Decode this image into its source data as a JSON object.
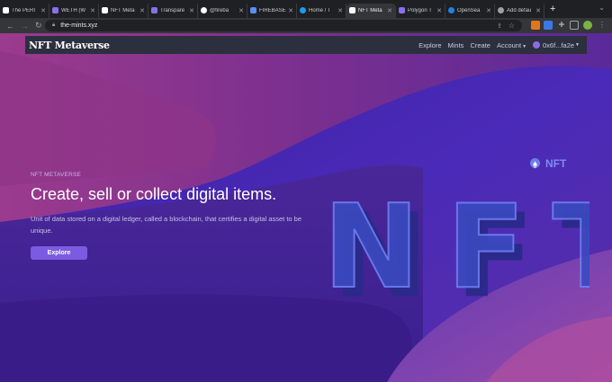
{
  "browser": {
    "tabs": [
      {
        "label": "The PERI",
        "icon": "w-icon",
        "color": "#ffffff"
      },
      {
        "label": "WETH (W",
        "icon": "polygon-icon",
        "color": "#8b6fe8"
      },
      {
        "label": "NFT Meta",
        "icon": "n-icon",
        "color": "#ffffff"
      },
      {
        "label": "Transpare",
        "icon": "polygon-icon",
        "color": "#8b6fe8"
      },
      {
        "label": "@fireba",
        "icon": "google-icon",
        "color": "#ffffff"
      },
      {
        "label": "FIREBASE",
        "icon": "firebase-icon",
        "color": "#5b8def"
      },
      {
        "label": "Home / T",
        "icon": "twitter-icon",
        "color": "#1d9bf0"
      },
      {
        "label": "NFT Meta",
        "icon": "n-icon",
        "color": "#ffffff",
        "active": true
      },
      {
        "label": "Polygon T",
        "icon": "polygon-icon",
        "color": "#8b6fe8"
      },
      {
        "label": "OpenSea",
        "icon": "opensea-icon",
        "color": "#2081e2"
      },
      {
        "label": "Add defau",
        "icon": "globe-icon",
        "color": "#9aa0a6"
      }
    ],
    "url": "the-mints.xyz"
  },
  "nav": {
    "brand": "NFT Metaverse",
    "links": [
      "Explore",
      "Mints",
      "Create"
    ],
    "account": "Account",
    "wallet": "0x6f...fa2e"
  },
  "hero": {
    "eyebrow": "NFT METAVERSE",
    "title": "Create, sell or collect digital items.",
    "description": "Unit of data stored on a digital ledger, called a blockchain, that certifies a digital asset to be unique.",
    "button": "Explore"
  },
  "art": {
    "small_text": "NFT",
    "big_text": "NFT"
  },
  "colors": {
    "accent": "#7b5ce0",
    "bg_purple": "#5b2a9c",
    "navbar": "#2c2f3e"
  }
}
